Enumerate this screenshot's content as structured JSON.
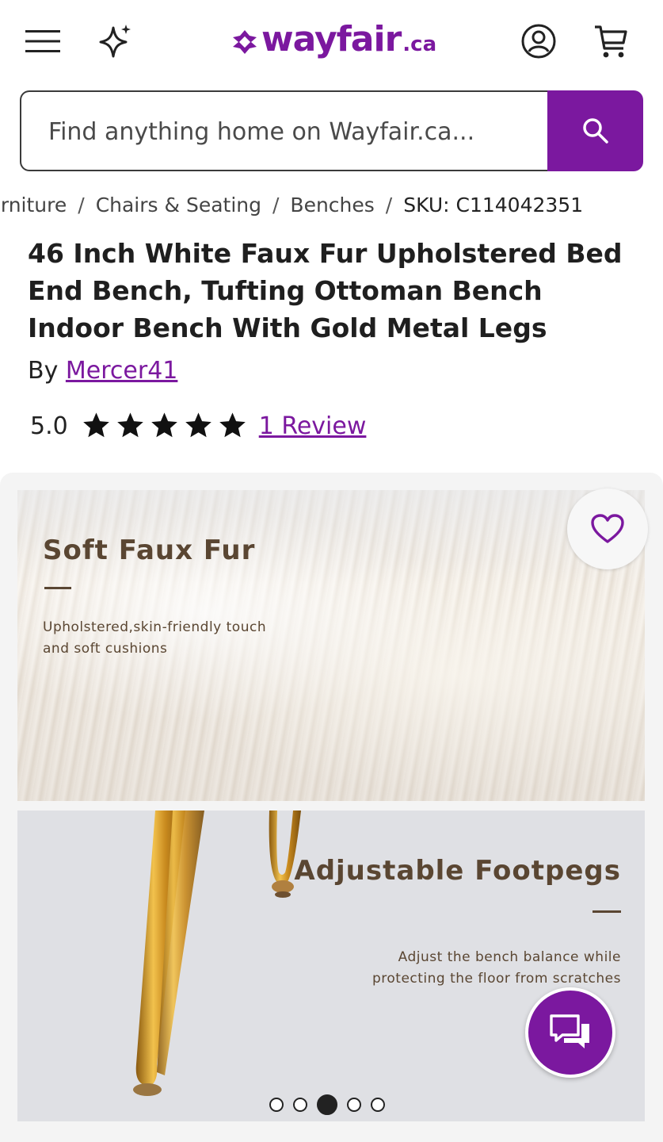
{
  "header": {
    "logo_word": "wayfair",
    "logo_tld": ".ca",
    "icons": {
      "menu": "hamburger-menu-icon",
      "ai": "sparkle-icon",
      "account": "account-icon",
      "cart": "cart-icon"
    },
    "brand_color": "#7b189f"
  },
  "search": {
    "placeholder": "Find anything home on Wayfair.ca...",
    "button_icon": "search-icon"
  },
  "breadcrumb": {
    "items": [
      "Furniture",
      "Chairs & Seating",
      "Benches"
    ],
    "sku": "SKU: C114042351"
  },
  "product": {
    "title": "46 Inch White Faux Fur Upholstered Bed End Bench, Tufting Ottoman Bench Indoor Bench With Gold Metal Legs",
    "by_label": "By",
    "brand": "Mercer41",
    "rating": "5.0",
    "stars": 5,
    "reviews_link": "1 Review"
  },
  "gallery": {
    "panel1": {
      "heading": "Soft Faux Fur",
      "subtext": "Upholstered,skin-friendly touch and soft cushions"
    },
    "panel2": {
      "heading": "Adjustable Footpegs",
      "subtext": "Adjust the bench balance while protecting the floor from scratches"
    },
    "dots_count": 5,
    "active_dot": 3,
    "favorite_icon": "heart-icon",
    "chat_icon": "chat-bubbles-icon"
  }
}
